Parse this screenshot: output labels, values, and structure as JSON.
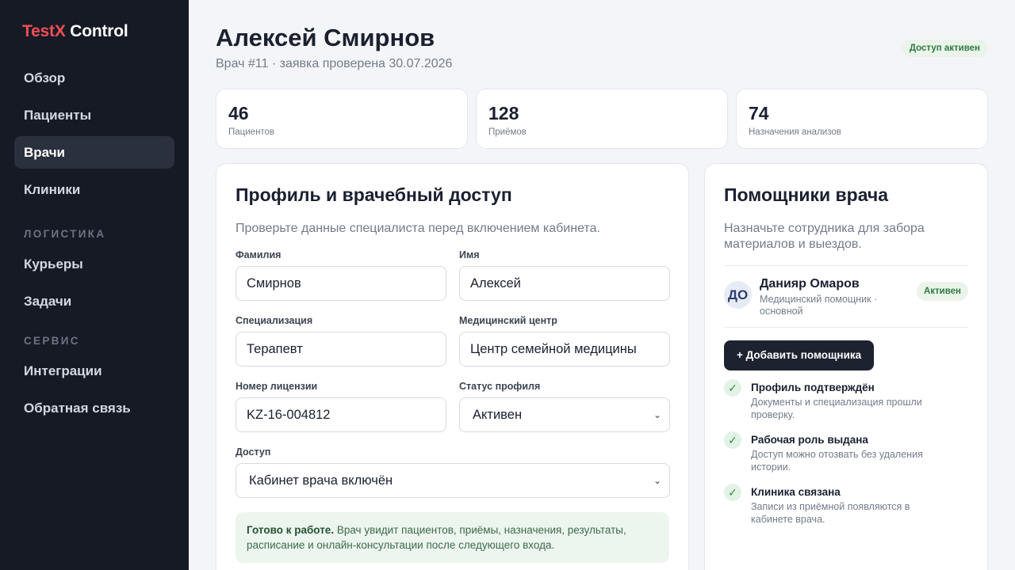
{
  "app": {
    "logo_accent": "TestX",
    "logo_rest": " Control",
    "accent_color": "#ef4f57"
  },
  "sidebar": {
    "items": [
      {
        "label": "Обзор"
      },
      {
        "label": "Пациенты"
      },
      {
        "label": "Врачи",
        "active": true
      },
      {
        "label": "Клиники"
      }
    ],
    "section_logistics": "ЛОГИСТИКА",
    "logistics_items": [
      {
        "label": "Курьеры"
      },
      {
        "label": "Задачи"
      }
    ],
    "section_service": "СЕРВИС",
    "service_items": [
      {
        "label": "Интеграции"
      },
      {
        "label": "Обратная связь"
      }
    ]
  },
  "header": {
    "title": "Алексей Смирнов",
    "subtitle": "Врач #11 · заявка проверена 30.07.2026",
    "badge": "Доступ активен"
  },
  "stats": [
    {
      "value": "46",
      "label": "Пациентов"
    },
    {
      "value": "128",
      "label": "Приёмов"
    },
    {
      "value": "74",
      "label": "Назначения анализов"
    }
  ],
  "profile": {
    "title": "Профиль и врачебный доступ",
    "description": "Проверьте данные специалиста перед включением кабинета.",
    "fields": {
      "last_name": {
        "label": "Фамилия",
        "value": "Смирнов"
      },
      "first_name": {
        "label": "Имя",
        "value": "Алексей"
      },
      "specialization": {
        "label": "Специализация",
        "value": "Терапевт"
      },
      "medical_center": {
        "label": "Медицинский центр",
        "value": "Центр семейной медицины"
      },
      "license": {
        "label": "Номер лицензии",
        "value": "KZ-16-004812"
      },
      "status": {
        "label": "Статус профиля",
        "value": "Активен"
      },
      "access": {
        "label": "Доступ",
        "value": "Кабинет врача включён"
      }
    },
    "notice_bold": "Готово к работе.",
    "notice_text": " Врач увидит пациентов, приёмы, назначения, результаты, расписание и онлайн-консультации после следующего входа."
  },
  "assistants": {
    "title": "Помощники врача",
    "description": "Назначьте сотрудника для забора материалов и выездов.",
    "assistant": {
      "initials": "ДО",
      "name": "Данияр Омаров",
      "role": "Медицинский помощник · основной",
      "status": "Активен"
    },
    "add_button": "+ Добавить помощника",
    "checklist": [
      {
        "title": "Профиль подтверждён",
        "desc": "Документы и специализация прошли проверку."
      },
      {
        "title": "Рабочая роль выдана",
        "desc": "Доступ можно отозвать без удаления истории."
      },
      {
        "title": "Клиника связана",
        "desc": "Записи из приёмной появляются в кабинете врача."
      }
    ]
  },
  "icons": {
    "check": "check-icon",
    "chevron": "chevron-down-icon"
  }
}
